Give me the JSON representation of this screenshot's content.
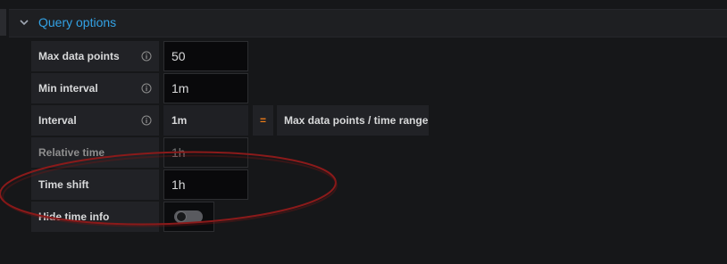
{
  "section": {
    "title": "Query options"
  },
  "rows": {
    "max_data_points": {
      "label": "Max data points",
      "value": "50"
    },
    "min_interval": {
      "label": "Min interval",
      "value": "1m"
    },
    "interval": {
      "label": "Interval",
      "value": "1m",
      "equals": "=",
      "formula": "Max data points / time range"
    },
    "relative_time": {
      "label": "Relative time",
      "placeholder": "1h"
    },
    "time_shift": {
      "label": "Time shift",
      "value": "1h"
    },
    "hide_time_info": {
      "label": "Hide time info",
      "enabled": false
    }
  },
  "colors": {
    "accent": "#33a2e5",
    "equals": "#eb7b18",
    "annotation": "#8b1a1a"
  }
}
